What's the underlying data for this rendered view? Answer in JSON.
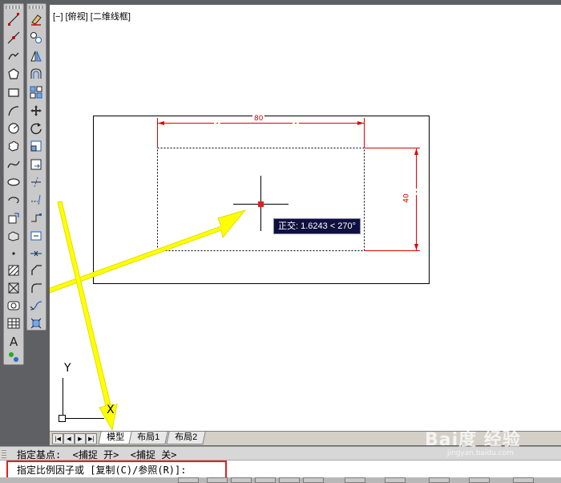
{
  "viewport": {
    "label": "[−] [俯视] [二维线框]"
  },
  "drawing": {
    "dim_horizontal": "80",
    "dim_vertical": "40",
    "tooltip": "正交: 1.6243 < 270°"
  },
  "ucs": {
    "y_label": "Y",
    "x_label": "X"
  },
  "tabs": [
    {
      "label": "模型",
      "active": true
    },
    {
      "label": "布局1"
    },
    {
      "label": "布局2"
    }
  ],
  "command": {
    "history": "指定基点:  <捕捉 开>  <捕捉 关>",
    "prompt": "指定比例因子或 [复制(C)/参照(R)]:"
  },
  "toolbar_left": [
    "line-icon",
    "construction-line-icon",
    "polyline-icon",
    "polygon-icon",
    "rectangle-icon",
    "arc-icon",
    "circle-icon",
    "revision-cloud-icon",
    "spline-icon",
    "ellipse-icon",
    "ellipse-arc-icon",
    "insert-block-icon",
    "make-block-icon",
    "point-icon",
    "hatch-icon",
    "gradient-icon",
    "region-icon",
    "table-icon",
    "multiline-text-icon",
    "add-selected-icon"
  ],
  "toolbar_modify": [
    "erase-icon",
    "copy-icon",
    "mirror-icon",
    "offset-icon",
    "array-icon",
    "move-icon",
    "rotate-icon",
    "scale-icon",
    "stretch-icon",
    "trim-icon",
    "extend-icon",
    "break-at-point-icon",
    "break-icon",
    "join-icon",
    "chamfer-icon",
    "fillet-icon",
    "blend-curves-icon",
    "explode-icon"
  ],
  "watermark": {
    "brand": "Bai度 经验",
    "url": "jingyan.baidu.com"
  },
  "colors": {
    "dimension": "#e00000",
    "highlight": "#e02020",
    "arrow": "#ffff00",
    "tooltip_bg": "#101040"
  }
}
